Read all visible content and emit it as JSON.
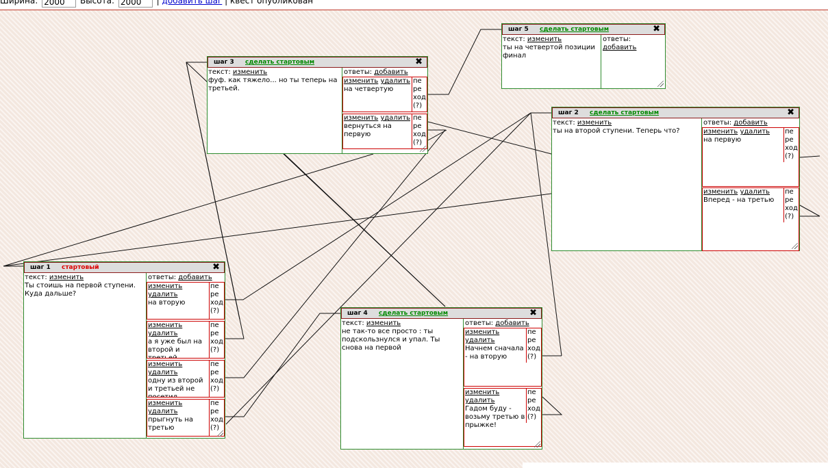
{
  "toolbar": {
    "width_label": "Ширина:",
    "width_value": "2000",
    "height_label": "Высота:",
    "height_value": "2000",
    "sep1": "|",
    "add_step": "добавить шаг",
    "sep2": "|",
    "status": "квест опубликован"
  },
  "common": {
    "text_label": "текст:",
    "edit": "изменить",
    "answers_label": "ответы:",
    "add": "добавить",
    "delete": "удалить",
    "transition": "пе\nре\nход\n(?)",
    "make_start": "сделать стартовым",
    "close_glyph": "✖"
  },
  "steps": {
    "s1": {
      "title": "шаг 1",
      "status": "стартовый",
      "text": "Ты стоишь на первой ступени. Куда дальше?",
      "answers": [
        "на вторую",
        "а я уже был на второй и третьей...",
        "одну из второй и третьей не посетил",
        "прыгнуть на третью"
      ]
    },
    "s2": {
      "title": "шаг 2",
      "text": "ты на второй ступени. Теперь что?",
      "answers": [
        "на первую",
        "Вперед - на третью"
      ]
    },
    "s3": {
      "title": "шаг 3",
      "text": "фуф. как тяжело... но ты теперь на третьей.",
      "answers": [
        "на четвертую",
        "вернуться на первую"
      ]
    },
    "s4": {
      "title": "шаг 4",
      "text": "не так-то все просто : ты подскользнулся и упал. Ты снова на первой",
      "answers": [
        "Начнем сначала - на вторую",
        "Гадом буду - возьму третью в прыжке!"
      ]
    },
    "s5": {
      "title": "шаг 5",
      "text": "ты на четвертой позиции финал",
      "answers": []
    }
  }
}
